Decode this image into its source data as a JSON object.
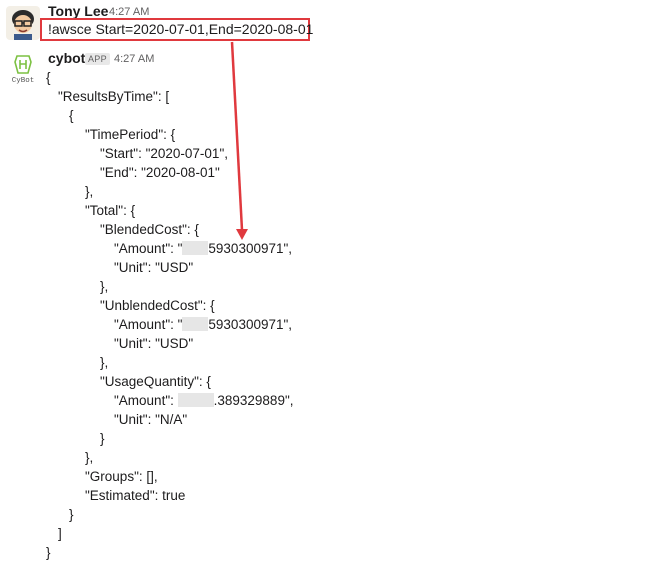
{
  "messages": {
    "user": {
      "name": "Tony Lee",
      "time": "4:27 AM",
      "command": "!awsce Start=2020-07-01,End=2020-08-01"
    },
    "bot": {
      "name": "cybot",
      "badge": "APP",
      "time": "4:27 AM",
      "avatar_label": "CyBot"
    }
  },
  "json_output": {
    "l1": "{",
    "l2": "\"ResultsByTime\": [",
    "l3": "{",
    "l4": "\"TimePeriod\": {",
    "l5": "\"Start\": \"2020-07-01\",",
    "l6": "\"End\": \"2020-08-01\"",
    "l7": "},",
    "l8": "\"Total\": {",
    "l9": "\"BlendedCost\": {",
    "l10_prefix": "\"Amount\": \"",
    "l10_suffix": "5930300971\",",
    "l11": "\"Unit\": \"USD\"",
    "l12": "},",
    "l13": "\"UnblendedCost\": {",
    "l14_prefix": "\"Amount\": \"",
    "l14_suffix": "5930300971\",",
    "l15": "\"Unit\": \"USD\"",
    "l16": "},",
    "l17": "\"UsageQuantity\": {",
    "l18_prefix": "\"Amount\": ",
    "l18_suffix": ".389329889\",",
    "l19": "\"Unit\": \"N/A\"",
    "l20": "}",
    "l21": "},",
    "l22": "\"Groups\": [],",
    "l23": "\"Estimated\": true",
    "l24": "}",
    "l25": "]",
    "l26": "}"
  },
  "colors": {
    "highlight": "#e0393e",
    "redaction": "#e6e6e6"
  }
}
